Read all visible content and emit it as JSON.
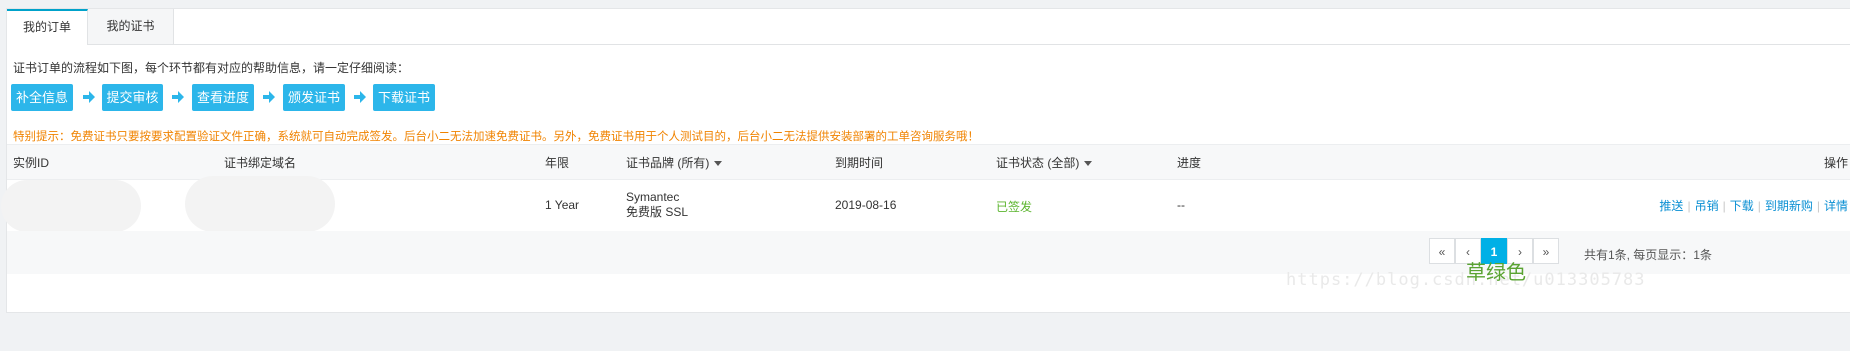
{
  "tabs": [
    {
      "label": "我的订单",
      "active": true
    },
    {
      "label": "我的证书",
      "active": false
    }
  ],
  "intro": "证书订单的流程如下图，每个环节都有对应的帮助信息，请一定仔细阅读：",
  "steps": [
    "补全信息",
    "提交审核",
    "查看进度",
    "颁发证书",
    "下载证书"
  ],
  "warning": "特别提示：免费证书只要按要求配置验证文件正确，系统就可自动完成签发。后台小二无法加速免费证书。另外，免费证书用于个人测试目的，后台小二无法提供安装部署的工单咨询服务哦！",
  "table": {
    "headers": {
      "instance_id": "实例ID",
      "domain": "证书绑定域名",
      "term": "年限",
      "brand": "证书品牌 (所有)",
      "expiry": "到期时间",
      "status": "证书状态 (全部)",
      "progress": "进度",
      "actions": "操作"
    },
    "rows": [
      {
        "term": "1 Year",
        "brand_line1": "Symantec",
        "brand_line2": "免费版 SSL",
        "expiry": "2019-08-16",
        "status": "已签发",
        "progress": "--",
        "actions": [
          "推送",
          "吊销",
          "下载",
          "到期新购",
          "详情"
        ]
      }
    ]
  },
  "pagination": {
    "total_text": "共有1条, 每页显示：1条",
    "first": "«",
    "prev": "‹",
    "current": "1",
    "next": "›",
    "last": "»"
  },
  "watermark": {
    "chinese": "草绿色",
    "url": "https://blog.csdn.net/u013305783"
  },
  "colors": {
    "accent": "#00b0e6",
    "step_button": "#2cb6ea",
    "warning": "#f08300",
    "status_ok": "#5cb52e",
    "link": "#0a8fd3"
  }
}
